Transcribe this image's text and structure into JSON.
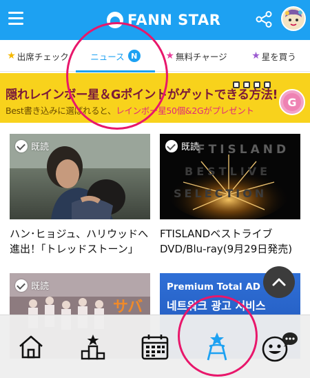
{
  "header": {
    "logo_text": "FANN STAR"
  },
  "tabs": [
    {
      "label": "出席チェック",
      "icon": "star-icon",
      "active": false
    },
    {
      "label": "ニュース",
      "badge": "N",
      "icon": null,
      "active": true
    },
    {
      "label": "無料チャージ",
      "icon": "star-outline-icon",
      "active": false
    },
    {
      "label": "星を買う",
      "icon": "rainbow-star-icon",
      "active": false
    }
  ],
  "banner": {
    "title": "隠れレインボー星＆Gポイントがゲットできる方法!",
    "sub_prefix": "Best書き込みに選ばれると、",
    "sub_highlight": "レインボー星50個&2G",
    "sub_suffix": "がプレゼント",
    "coin_letter": "G"
  },
  "cards": [
    {
      "read_label": "既読",
      "title": "ハン･ヒョジュ、ハリウッドへ進出！｢トレッドストーン｣"
    },
    {
      "read_label": "既読",
      "title": "FTISLANDベストライブDVD/Blu-ray(9月29日発売)",
      "thumb_text": "FTISLAND BESTLIVE SELECTION"
    },
    {
      "read_label": "既読",
      "title": ""
    },
    {
      "read_label": "",
      "title": "",
      "ad_line1": "Premium Total AD",
      "ad_line2": "네트워크 광고 서비스"
    }
  ],
  "bottom_nav": [
    {
      "name": "home",
      "icon": "home-icon",
      "active": false
    },
    {
      "name": "ranking",
      "icon": "ranking-podium-icon",
      "active": false
    },
    {
      "name": "calendar",
      "icon": "calendar-icon",
      "active": false
    },
    {
      "name": "star-vote",
      "icon": "star-podium-icon",
      "active": true
    },
    {
      "name": "fan-talk",
      "icon": "smiley-chat-icon",
      "active": false
    }
  ],
  "colors": {
    "primary": "#1da1f2",
    "banner_bg": "#f8d21c",
    "annotation": "#e8176b",
    "highlight": "#e0287a"
  }
}
